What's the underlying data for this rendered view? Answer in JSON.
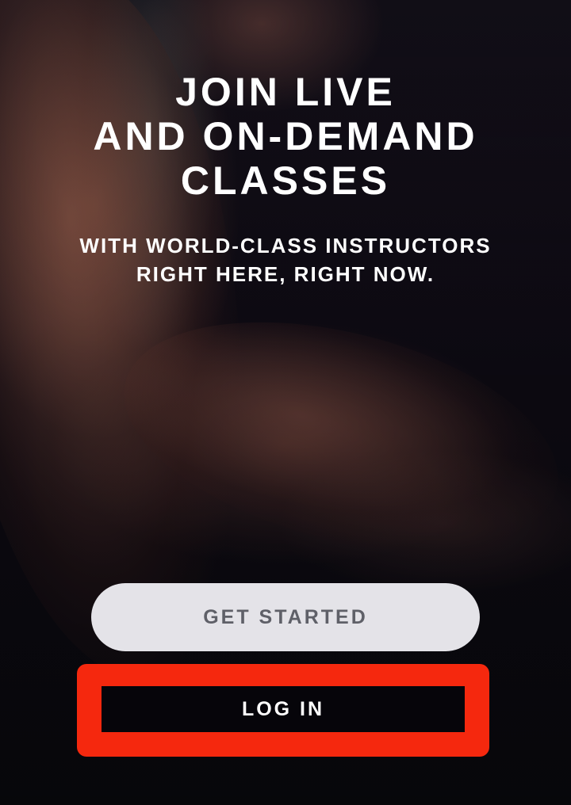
{
  "hero": {
    "headline_lines": [
      "JOIN LIVE",
      "AND ON-DEMAND",
      "CLASSES"
    ],
    "subline_lines": [
      "WITH WORLD-CLASS INSTRUCTORS",
      "RIGHT HERE, RIGHT NOW."
    ]
  },
  "actions": {
    "get_started_label": "GET STARTED",
    "login_label": "LOG IN"
  },
  "colors": {
    "background": "#0b0a12",
    "primary_button_bg": "#e4e3e8",
    "primary_button_text": "#5f6068",
    "login_button_bg": "#06050a",
    "highlight": "#f5280e"
  }
}
